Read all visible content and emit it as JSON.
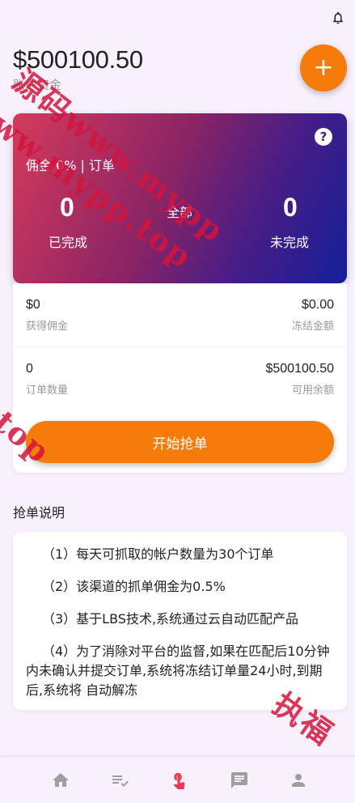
{
  "header": {
    "balance": "$500100.50",
    "balance_label": "账户资金",
    "fab_label": "+"
  },
  "hero": {
    "commission": "佣金 0% |  订单",
    "completed_count": "0",
    "completed_label": "已完成",
    "all_label": "全部",
    "pending_count": "0",
    "pending_label": "未完成",
    "help_label": "?"
  },
  "stats": {
    "earned_value": "$0",
    "earned_label": "获得佣金",
    "frozen_value": "$0.00",
    "frozen_label": "冻结金额",
    "orders_value": "0",
    "orders_label": "订单数量",
    "available_value": "$500100.50",
    "available_label": "可用余额"
  },
  "actions": {
    "start_label": "开始抢单"
  },
  "rules": {
    "title": "抢单说明",
    "items": [
      "（1）每天可抓取的帐户数量为30个订单",
      "（2）该渠道的抓单佣金为0.5%",
      "（3）基于LBS技术,系统通过云自动匹配产品",
      "（4）为了消除对平台的监督,如果在匹配后10分钟内未确认并提交订单,系统将冻结订单量24小时,到期后,系统将 自动解冻"
    ]
  },
  "watermark": {
    "text1": "源码www.mypp",
    "text2": "www.mypp.top",
    "text3": "p.top",
    "text4": "执福"
  },
  "colors": {
    "accent": "#f57c0a",
    "nav_active": "#e53950",
    "nav_inactive": "#9e9e9e",
    "hero_start": "#d53a5c",
    "hero_end": "#141f9a"
  },
  "nav": {
    "icons": [
      "home-icon",
      "order-list-icon",
      "grab-order-icon",
      "messages-icon",
      "profile-icon"
    ],
    "active_index": 2
  }
}
